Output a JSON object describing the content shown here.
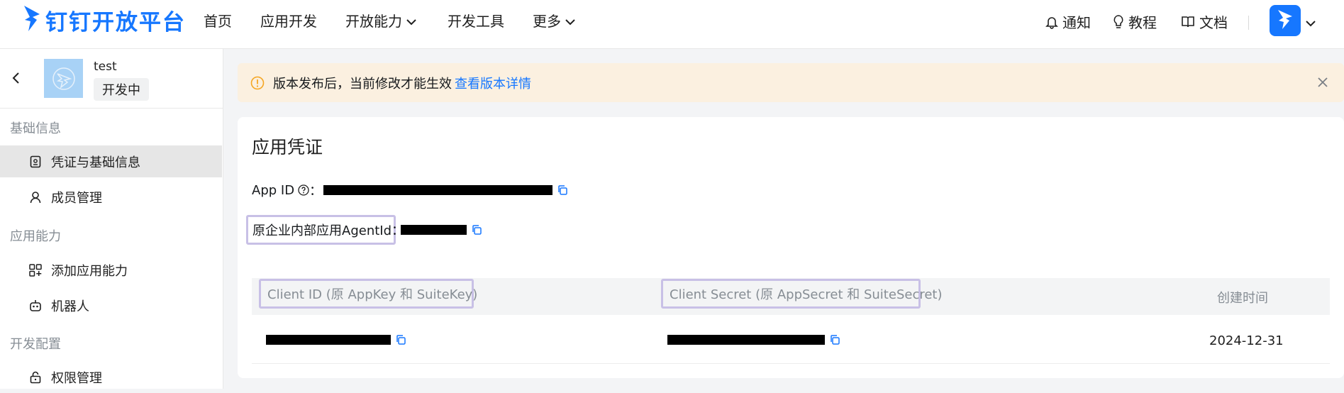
{
  "brand": {
    "name": "钉钉开放平台",
    "color": "#1677ff"
  },
  "nav": {
    "items": [
      {
        "label": "首页",
        "dropdown": false
      },
      {
        "label": "应用开发",
        "dropdown": false
      },
      {
        "label": "开放能力",
        "dropdown": true
      },
      {
        "label": "开发工具",
        "dropdown": false
      },
      {
        "label": "更多",
        "dropdown": true
      }
    ],
    "right": [
      {
        "label": "通知",
        "icon": "bell-icon"
      },
      {
        "label": "教程",
        "icon": "lightbulb-icon"
      },
      {
        "label": "文档",
        "icon": "book-icon"
      }
    ]
  },
  "app": {
    "name": "test",
    "status": "开发中"
  },
  "sidebar": {
    "groups": [
      {
        "title": "基础信息",
        "items": [
          {
            "label": "凭证与基础信息",
            "icon": "credential-icon",
            "active": true
          },
          {
            "label": "成员管理",
            "icon": "user-icon",
            "active": false
          }
        ]
      },
      {
        "title": "应用能力",
        "items": [
          {
            "label": "添加应用能力",
            "icon": "apps-add-icon",
            "active": false
          },
          {
            "label": "机器人",
            "icon": "robot-icon",
            "active": false
          }
        ]
      },
      {
        "title": "开发配置",
        "items": [
          {
            "label": "权限管理",
            "icon": "lock-icon",
            "active": false
          }
        ]
      }
    ]
  },
  "alert": {
    "text": "版本发布后，当前修改才能生效",
    "link": "查看版本详情",
    "bg_color": "#fbf0e0",
    "icon_color": "#f5a623"
  },
  "credentials": {
    "title": "应用凭证",
    "app_id_label": "App ID",
    "app_id_colon": "：",
    "agent_id_label": "原企业内部应用AgentId：",
    "table": {
      "headers": [
        "Client ID (原 AppKey 和 SuiteKey)",
        "Client Secret (原 AppSecret 和 SuiteSecret)",
        "创建时间"
      ],
      "rows": [
        {
          "created": "2024-12-31"
        }
      ]
    },
    "highlight_color": "#c8c0e6"
  }
}
